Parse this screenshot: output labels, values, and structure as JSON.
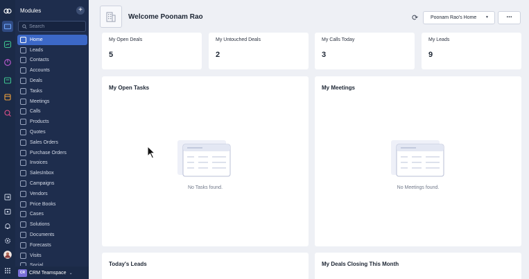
{
  "sidebar": {
    "title": "Modules",
    "add_label": "+",
    "search_placeholder": "Search",
    "items": [
      {
        "label": "Home",
        "icon": "home-icon",
        "active": true
      },
      {
        "label": "Leads",
        "icon": "leads-icon"
      },
      {
        "label": "Contacts",
        "icon": "contacts-icon"
      },
      {
        "label": "Accounts",
        "icon": "accounts-icon"
      },
      {
        "label": "Deals",
        "icon": "deals-icon"
      },
      {
        "label": "Tasks",
        "icon": "tasks-icon"
      },
      {
        "label": "Meetings",
        "icon": "meetings-icon"
      },
      {
        "label": "Calls",
        "icon": "calls-icon"
      },
      {
        "label": "Products",
        "icon": "products-icon"
      },
      {
        "label": "Quotes",
        "icon": "quotes-icon"
      },
      {
        "label": "Sales Orders",
        "icon": "sales-orders-icon"
      },
      {
        "label": "Purchase Orders",
        "icon": "purchase-orders-icon"
      },
      {
        "label": "Invoices",
        "icon": "invoices-icon"
      },
      {
        "label": "SalesInbox",
        "icon": "salesinbox-icon"
      },
      {
        "label": "Campaigns",
        "icon": "campaigns-icon"
      },
      {
        "label": "Vendors",
        "icon": "vendors-icon"
      },
      {
        "label": "Price Books",
        "icon": "price-books-icon"
      },
      {
        "label": "Cases",
        "icon": "cases-icon"
      },
      {
        "label": "Solutions",
        "icon": "solutions-icon"
      },
      {
        "label": "Documents",
        "icon": "documents-icon"
      },
      {
        "label": "Forecasts",
        "icon": "forecasts-icon"
      },
      {
        "label": "Visits",
        "icon": "visits-icon"
      },
      {
        "label": "Social",
        "icon": "social-icon"
      }
    ],
    "footer": {
      "badge": "CR",
      "name": "CRM Teamspace",
      "chevron": "⌄"
    }
  },
  "header": {
    "welcome": "Welcome Poonam Rao",
    "refresh_icon": "⟳",
    "home_select": "Poonam Rao's Home",
    "home_caret": "▼",
    "more_label": "..."
  },
  "stats": [
    {
      "label": "My Open Deals",
      "value": "5"
    },
    {
      "label": "My Untouched Deals",
      "value": "2"
    },
    {
      "label": "My Calls Today",
      "value": "3"
    },
    {
      "label": "My Leads",
      "value": "9"
    }
  ],
  "panels": {
    "open_tasks": {
      "title": "My Open Tasks",
      "empty": "No Tasks found."
    },
    "meetings": {
      "title": "My Meetings",
      "empty": "No Meetings found."
    },
    "todays_leads": {
      "title": "Today's Leads"
    },
    "deals_closing": {
      "title": "My Deals Closing This Month"
    }
  },
  "colors": {
    "rail": "#1b2a47",
    "sidebar": "#1e2d4d",
    "active": "#3c68c7",
    "background": "#eef0f5"
  }
}
